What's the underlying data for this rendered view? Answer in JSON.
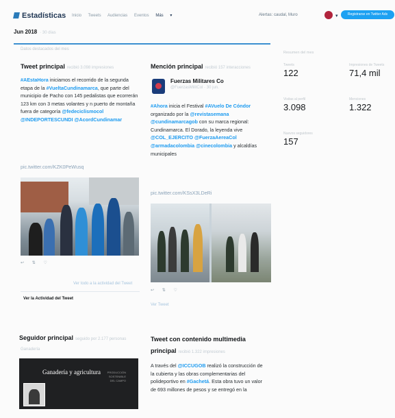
{
  "header": {
    "brand": "Estadísticas",
    "nav": [
      "Inicio",
      "Tweets",
      "Audiencias",
      "Eventos",
      "Más"
    ],
    "account_label": "Alertas: caudal, Muro",
    "promo_button": "Registrarse en Twitter Ads"
  },
  "period": {
    "month": "Jun 2018",
    "range_text": "· 30 días"
  },
  "subheader": "Datos destacados del mes",
  "top_tweet": {
    "title": "Tweet principal",
    "subtitle": "recibió 3.098 impresiones",
    "text_parts": [
      {
        "t": "#AEstaHora",
        "hl": true
      },
      {
        "t": " iniciamos el recorrido de la segunda etapa de la ",
        "hl": false
      },
      {
        "t": "#VueltaCundinamarca",
        "hl": true
      },
      {
        "t": ", que parte del municipio de Pacho con 145 pedalistas que ecorrerán 123 km con 3 metas volantes y n puerto de montaña fuera de categoría ",
        "hl": false
      },
      {
        "t": "@fedeciclismocol",
        "hl": true
      },
      {
        "t": " ",
        "hl": false
      },
      {
        "t": "@INDEPORTESCUNDI",
        "hl": true
      },
      {
        "t": " ",
        "hl": false
      },
      {
        "t": "@AcordCundinamar",
        "hl": true
      }
    ],
    "link": "pic.twitter.com/KZK0PeWusq",
    "see_link": "Ver todo a la actividad del Tweet",
    "activity_label": "Ver la Actividad del Tweet"
  },
  "top_mention": {
    "title": "Mención principal",
    "subtitle": "recibió 157 interacciones",
    "author_name": "Fuerzas Militares Co",
    "author_handle": "@FuerzasMilitCol · 30 jun.",
    "text_parts": [
      {
        "t": "#Ahora",
        "hl": true
      },
      {
        "t": " inicia el Festival ",
        "hl": false
      },
      {
        "t": "#AVuelo De Cóndor",
        "hl": true
      },
      {
        "t": " organizado por la ",
        "hl": false
      },
      {
        "t": "@revistasemana",
        "hl": true
      },
      {
        "t": " ",
        "hl": false
      },
      {
        "t": "@cundinamarcagob",
        "hl": true
      },
      {
        "t": " con su marca regional: Cundinamarca. El Dorado, la leyenda vive ",
        "hl": false
      },
      {
        "t": "@COL_EJERCITO",
        "hl": true
      },
      {
        "t": " ",
        "hl": false
      },
      {
        "t": "@FuerzaAereaCol",
        "hl": true
      },
      {
        "t": " ",
        "hl": false
      },
      {
        "t": "@armadacolombia",
        "hl": true
      },
      {
        "t": " ",
        "hl": false
      },
      {
        "t": "@cinecolombia",
        "hl": true
      },
      {
        "t": " y alcaldías municipales",
        "hl": false
      }
    ],
    "link": "pic.twitter.com/KSsX3LDeRi",
    "see_link": "Ver Tweet"
  },
  "stats": {
    "heading": "Resumen del mes",
    "items": [
      {
        "label": "Tweets",
        "value": "122"
      },
      {
        "label": "Impresiones de Tweets",
        "value": "71,4 mil"
      },
      {
        "label": "Visitas al perfil",
        "value": "3.098"
      },
      {
        "label": "Menciones",
        "value": "1.322"
      },
      {
        "label": "Nuevos seguidores",
        "value": "157"
      }
    ]
  },
  "top_follower": {
    "title": "Seguidor principal",
    "subtitle": "seguido por 2.177 personas",
    "sub_line": "Ganadería",
    "banner_text": "Ganadería y agricultura",
    "banner_small": [
      "PRODUCCIÓN",
      "SOSTENIBLE",
      "DEL CAMPO"
    ]
  },
  "top_media": {
    "title": "Tweet con contenido multimedia",
    "title_line2": "principal",
    "subtitle": "recibió 1.322 impresiones",
    "text_parts": [
      {
        "t": "A través del ",
        "hl": false
      },
      {
        "t": "@ICCUGOB",
        "hl": true
      },
      {
        "t": " realizó la construcción de la cubierta y las obras complementarias del polideportivo en ",
        "hl": false
      },
      {
        "t": "#Gachetá",
        "hl": true
      },
      {
        "t": ". Esta obra tuvo un valor de 693 millones de pesos y se entregó en la",
        "hl": false
      }
    ]
  }
}
